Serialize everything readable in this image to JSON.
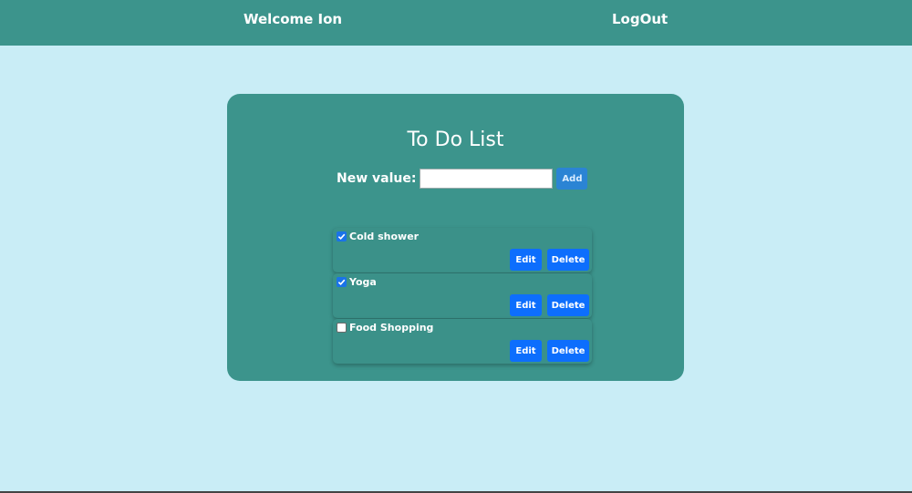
{
  "header": {
    "welcome_text": "Welcome Ion",
    "logout_label": "LogOut"
  },
  "todo": {
    "title": "To Do List",
    "new_value_label": "New value:",
    "new_value_input": "",
    "add_label": "Add",
    "items": [
      {
        "text": "Cold shower",
        "checked": true,
        "edit_label": "Edit",
        "delete_label": "Delete"
      },
      {
        "text": "Yoga",
        "checked": true,
        "edit_label": "Edit",
        "delete_label": "Delete"
      },
      {
        "text": "Food Shopping",
        "checked": false,
        "edit_label": "Edit",
        "delete_label": "Delete"
      }
    ]
  },
  "colors": {
    "page_bg": "#c9edf6",
    "header_bg": "#3c948c",
    "card_bg": "#3c948c",
    "button_blue": "#0d6efd"
  }
}
